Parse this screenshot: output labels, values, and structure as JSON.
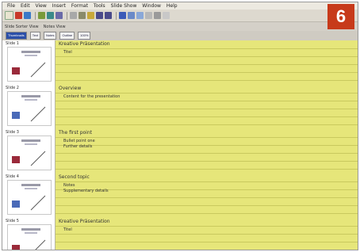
{
  "menu": [
    "File",
    "Edit",
    "View",
    "Insert",
    "Format",
    "Tools",
    "Slide Show",
    "Window",
    "Help"
  ],
  "toolbar2": [
    "Slide Sorter View",
    "Notes View"
  ],
  "toolbar3": {
    "tabs": [
      "Thumbnails",
      "Text",
      "Notes",
      "Outline"
    ],
    "zoom": "100%"
  },
  "badge": "6",
  "slides": [
    {
      "num": "Slide 1",
      "title": "Kreative Präsentation",
      "bullets": [
        "Titel"
      ]
    },
    {
      "num": "Slide 2",
      "title": "Overview",
      "bullets": [
        "Content for the presentation"
      ]
    },
    {
      "num": "Slide 3",
      "title": "The first point",
      "bullets": [
        "Bullet point one",
        "Further details"
      ]
    },
    {
      "num": "Slide 4",
      "title": "Second topic",
      "bullets": [
        "Notes",
        "Supplementary details"
      ]
    },
    {
      "num": "Slide 5",
      "title": "Kreative Präsentation",
      "bullets": [
        "Titel"
      ]
    }
  ]
}
